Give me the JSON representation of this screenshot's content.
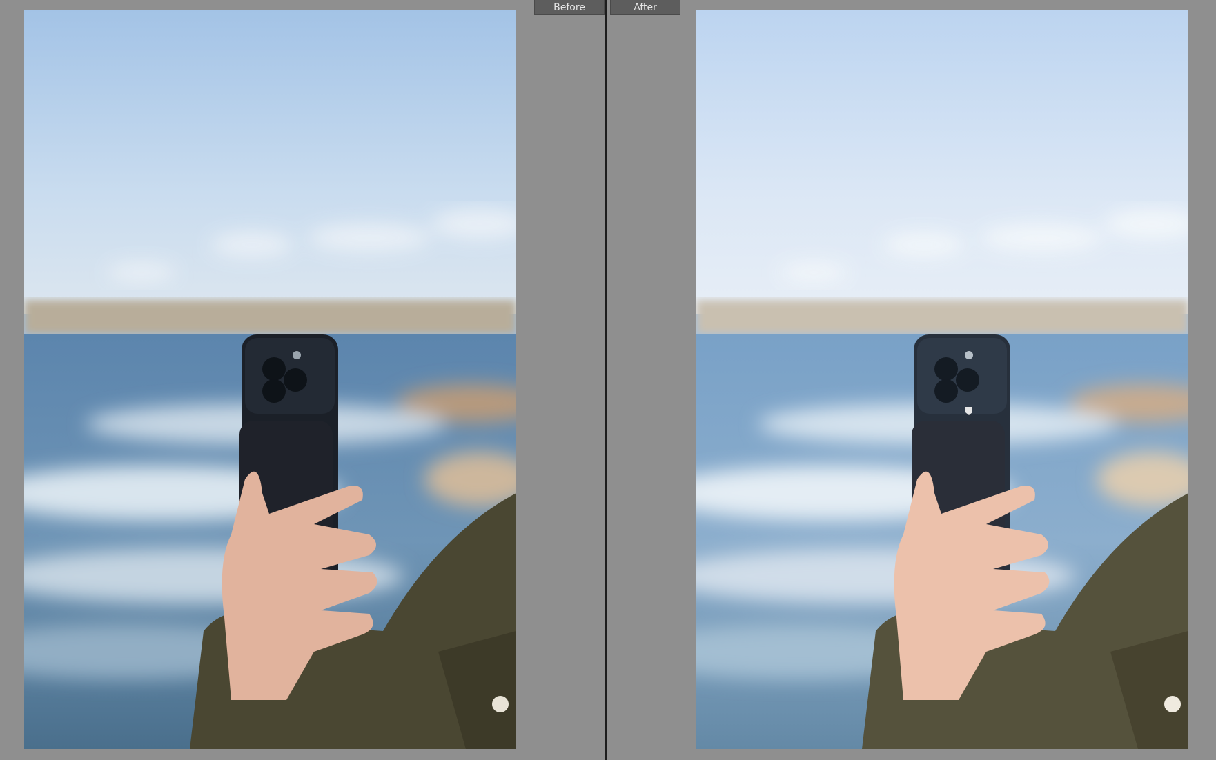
{
  "compare_view": {
    "before_label": "Before",
    "after_label": "After"
  },
  "panels": [
    {
      "id": "before",
      "tone": "original"
    },
    {
      "id": "after",
      "tone": "edited-brighter"
    }
  ],
  "colors": {
    "background": "#8f8f8f",
    "divider": "#1d1d1d",
    "label_bg": "#5d5d5d",
    "label_text": "#e6e6e6"
  }
}
